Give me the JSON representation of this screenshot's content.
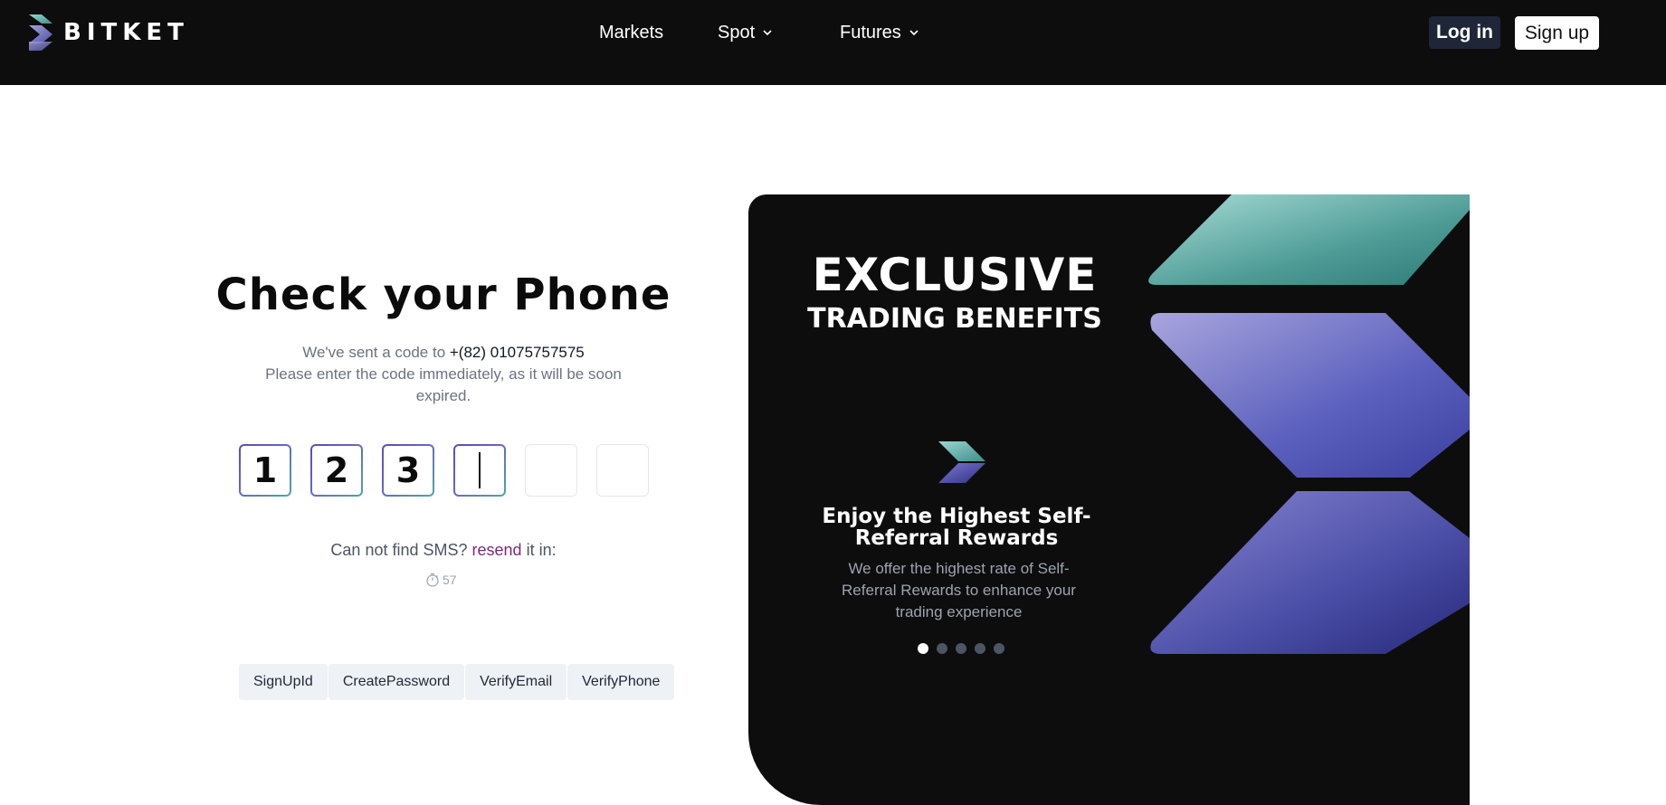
{
  "header": {
    "brand": "BITKET",
    "nav": {
      "markets": "Markets",
      "spot": "Spot",
      "futures": "Futures"
    },
    "login": "Log in",
    "signup": "Sign up"
  },
  "verify": {
    "title": "Check your Phone",
    "sent_prefix": "We've sent a code to ",
    "phone": "+(82) 01075757575",
    "instruction": "Please enter the code immediately, as it will be soon expired.",
    "code_digits": [
      "1",
      "2",
      "3",
      "",
      "",
      ""
    ],
    "sms_prefix": "Can not find SMS? ",
    "resend": "resend",
    "sms_suffix": " it in:",
    "countdown": "57"
  },
  "steps": [
    "SignUpId",
    "CreatePassword",
    "VerifyEmail",
    "VerifyPhone"
  ],
  "promo": {
    "heading": "EXCLUSIVE",
    "subheading": "TRADING BENEFITS",
    "slide_title": "Enjoy the Highest Self-Referral Rewards",
    "slide_text": "We offer the highest rate of Self-Referral Rewards to enhance your trading experience",
    "slide_count": 5,
    "active_slide": 1
  },
  "colors": {
    "header_bg": "#0d0d0d",
    "accent_purple": "#7b2a78",
    "teal": "#4fa7a0",
    "indigo": "#5a4fb0"
  }
}
